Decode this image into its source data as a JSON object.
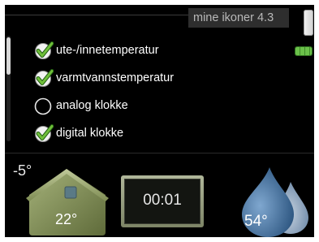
{
  "header": {
    "title": "mine ikoner 4.3"
  },
  "options": [
    {
      "label": "ute-/innetemperatur",
      "checked": true
    },
    {
      "label": "varmtvannstemperatur",
      "checked": true
    },
    {
      "label": "analog klokke",
      "checked": false
    },
    {
      "label": "digital klokke",
      "checked": true
    }
  ],
  "preview": {
    "outdoor_temp": "-5°",
    "indoor_temp": "22°",
    "clock": "00:01",
    "hot_water_temp": "54°"
  },
  "icons": {
    "checkbox_checked": "check-circle-icon",
    "checkbox_unchecked": "empty-circle-icon",
    "house": "house-icon",
    "water": "water-drop-icon",
    "page_indicator": "page-indicator-icon",
    "battery": "battery-level-icon"
  },
  "colors": {
    "background": "#000000",
    "check_green": "#6fbf3a",
    "house": "#7f8d54",
    "drop_blue": "#3d6d9c"
  }
}
